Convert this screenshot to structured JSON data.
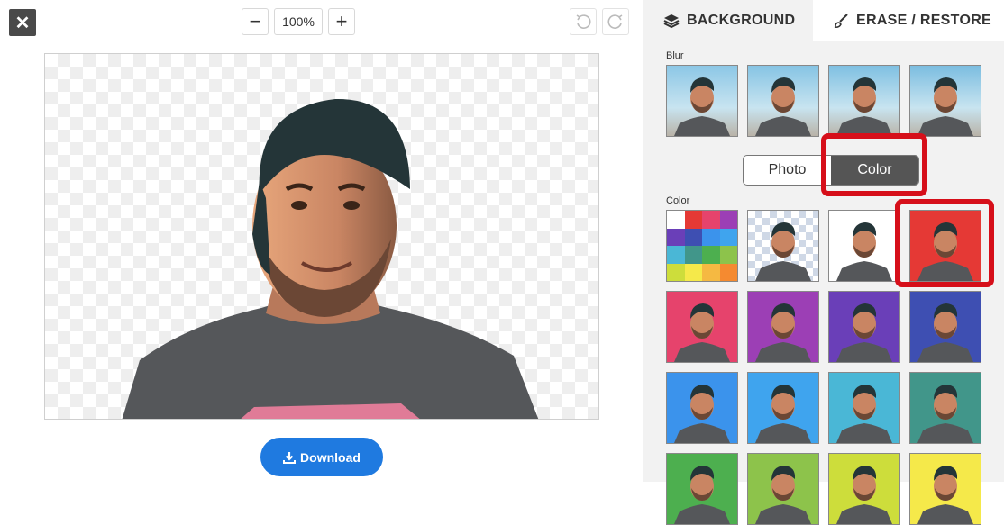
{
  "toolbar": {
    "close_label": "✕",
    "zoom_out": "−",
    "zoom_level": "100%",
    "zoom_in": "+"
  },
  "download_label": "Download",
  "tabs": {
    "background": "BACKGROUND",
    "erase_restore": "ERASE / RESTORE"
  },
  "blur_label": "Blur",
  "color_label": "Color",
  "toggle": {
    "photo": "Photo",
    "color": "Color",
    "selected": "Color"
  },
  "blur_thumbs": [
    "#8cc7e6",
    "#86c4e4",
    "#7fc0e2",
    "#7bbde0"
  ],
  "color_thumbs": [
    {
      "type": "palette"
    },
    {
      "type": "transparent"
    },
    {
      "type": "solid",
      "color": "#ffffff"
    },
    {
      "type": "solid",
      "color": "#e53935",
      "selected": true
    },
    {
      "type": "solid",
      "color": "#e6436c"
    },
    {
      "type": "solid",
      "color": "#9c3fb5"
    },
    {
      "type": "solid",
      "color": "#6a3fb8"
    },
    {
      "type": "solid",
      "color": "#3e4fb2"
    },
    {
      "type": "solid",
      "color": "#3b93ec"
    },
    {
      "type": "solid",
      "color": "#3fa4ee"
    },
    {
      "type": "solid",
      "color": "#4ab7d6"
    },
    {
      "type": "solid",
      "color": "#41968a"
    },
    {
      "type": "solid",
      "color": "#4daf4f"
    },
    {
      "type": "solid",
      "color": "#8dc34b"
    },
    {
      "type": "solid",
      "color": "#cddd3b"
    },
    {
      "type": "solid",
      "color": "#f5e94a"
    }
  ],
  "palette_colors": [
    "#ffffff",
    "#e53935",
    "#e6436c",
    "#9c3fb5",
    "#6a3fb8",
    "#3e4fb2",
    "#3b93ec",
    "#3fa4ee",
    "#4ab7d6",
    "#41968a",
    "#4daf4f",
    "#8dc34b",
    "#cddd3b",
    "#f5e94a",
    "#f5b942",
    "#f58a30"
  ],
  "highlight_color": "#d60f1a",
  "accent": "#1f7ae0"
}
